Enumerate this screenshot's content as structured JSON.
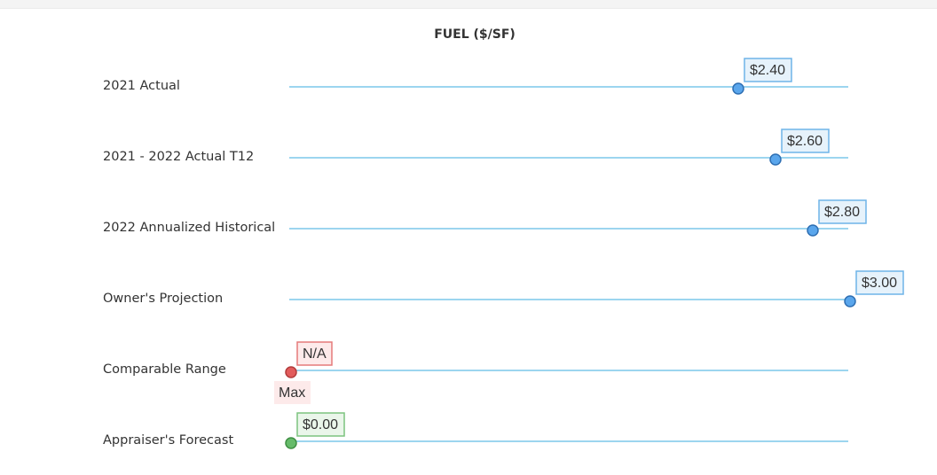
{
  "chart_data": {
    "type": "scatter",
    "title": "FUEL ($/SF)",
    "xlim": [
      0,
      3.0
    ],
    "rows": [
      {
        "label": "2021 Actual",
        "value": 2.4,
        "value_label": "$2.40",
        "color": "#5aa6ec",
        "box_fill": "#e6f2fb",
        "box_border": "#6fb4e8"
      },
      {
        "label": "2021 - 2022 Actual T12",
        "value": 2.6,
        "value_label": "$2.60",
        "color": "#5aa6ec",
        "box_fill": "#e6f2fb",
        "box_border": "#6fb4e8"
      },
      {
        "label": "2022 Annualized Historical",
        "value": 2.8,
        "value_label": "$2.80",
        "color": "#5aa6ec",
        "box_fill": "#e6f2fb",
        "box_border": "#6fb4e8"
      },
      {
        "label": "Owner's Projection",
        "value": 3.0,
        "value_label": "$3.00",
        "color": "#5aa6ec",
        "box_fill": "#e6f2fb",
        "box_border": "#6fb4e8"
      },
      {
        "label": "Comparable Range",
        "value": 0,
        "value_label": "N/A",
        "sub_label": "Max",
        "color": "#e25c5c",
        "box_fill": "#fdeaea",
        "box_border": "#e57a7a"
      },
      {
        "label": "Appraiser's Forecast",
        "value": 0.0,
        "value_label": "$0.00",
        "color": "#66bb6a",
        "box_fill": "#eaf6ea",
        "box_border": "#7cc47f"
      }
    ]
  }
}
